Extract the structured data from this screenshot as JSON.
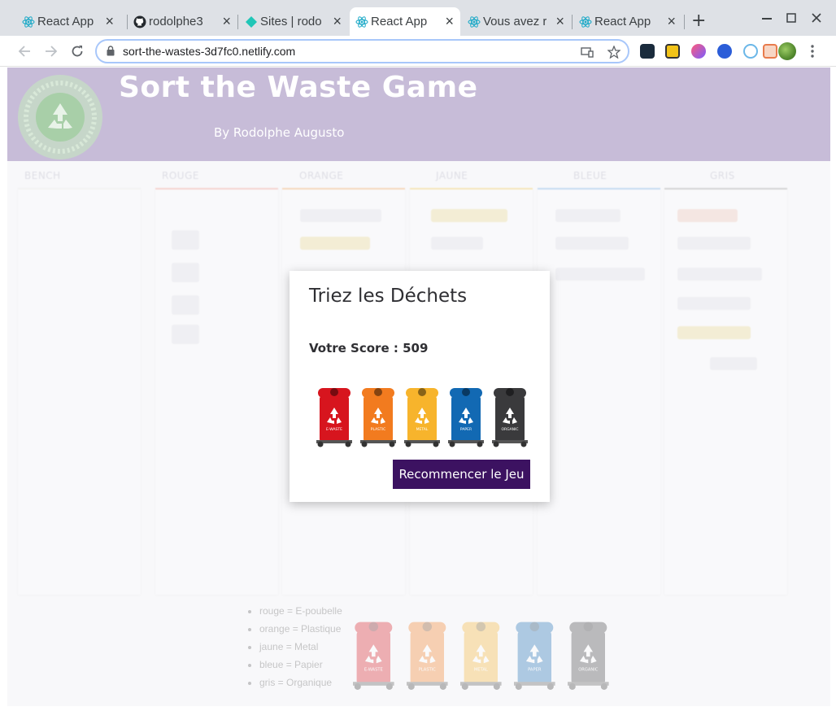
{
  "browser": {
    "tabs": [
      {
        "label": "React App",
        "icon": "react-icon"
      },
      {
        "label": "rodolphe3",
        "icon": "github-icon"
      },
      {
        "label": "Sites | rodo",
        "icon": "netlify-icon"
      },
      {
        "label": "React App",
        "icon": "react-icon",
        "active": true
      },
      {
        "label": "Vous avez r",
        "icon": "react-icon"
      },
      {
        "label": "React App",
        "icon": "react-icon"
      }
    ],
    "url": "sort-the-wastes-3d7fc0.netlify.com",
    "close_glyph": "×",
    "new_tab_glyph": "+"
  },
  "app": {
    "title": "Sort the Waste Game",
    "author": "By Rodolphe Augusto",
    "columns": [
      "BENCH",
      "ROUGE",
      "ORANGE",
      "JAUNE",
      "BLEUE",
      "GRIS"
    ],
    "column_colors": [
      "#e0e0e0",
      "#f4b9b2",
      "#f6c08c",
      "#f5d98a",
      "#9fc4ec",
      "#b8b8b8"
    ],
    "legend": [
      "rouge = E-poubelle",
      "orange = Plastique",
      "jaune = Metal",
      "bleue = Papier",
      "gris = Organique"
    ],
    "bins": [
      {
        "label": "E-WASTE",
        "color": "#d7151e"
      },
      {
        "label": "PLASTIC",
        "color": "#f27b1f"
      },
      {
        "label": "METAL",
        "color": "#f7b42c"
      },
      {
        "label": "PAPER",
        "color": "#1269b3"
      },
      {
        "label": "ORGANIC",
        "color": "#3a3a3c"
      }
    ]
  },
  "modal": {
    "title": "Triez les Déchets",
    "score_text": "Votre Score : 509",
    "restart_label": "Recommencer le Jeu"
  }
}
